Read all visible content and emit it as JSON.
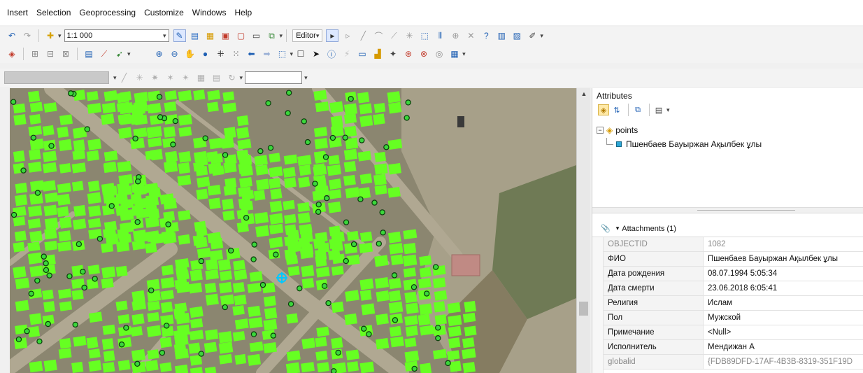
{
  "menu": [
    "Insert",
    "Selection",
    "Geoprocessing",
    "Customize",
    "Windows",
    "Help"
  ],
  "toolbar1": {
    "scale": "1:1 000",
    "editor_label": "Editor"
  },
  "toolbar3": {
    "combo_value": ""
  },
  "icons": [
    "undo-icon",
    "redo-icon",
    "add-data-icon",
    "zoom-in-icon",
    "zoom-out-icon",
    "pan-icon",
    "full-extent-icon",
    "identify-icon",
    "find-icon",
    "select-icon",
    "arrow-icon"
  ],
  "colors": {
    "parcel": "#66ff22",
    "point_fill": "#3bd63b",
    "point_stroke": "#0a3a0a",
    "selected": "#00c8ff"
  },
  "attributes_panel": {
    "title": "Attributes",
    "layer": "points",
    "feature": "Пшенбаев Бауыржан Ақылбек ұлы",
    "attachments_label": "Attachments (1)",
    "fields": [
      {
        "key": "OBJECTID",
        "value": "1082"
      },
      {
        "key": "ФИО",
        "value": "Пшенбаев Бауыржан Ақылбек ұлы"
      },
      {
        "key": "Дата рождения",
        "value": "08.07.1994 5:05:34"
      },
      {
        "key": "Дата смерти",
        "value": "23.06.2018 6:05:41"
      },
      {
        "key": "Религия",
        "value": "Ислам"
      },
      {
        "key": "Пол",
        "value": "Мужской"
      },
      {
        "key": "Примечание",
        "value": "<Null>"
      },
      {
        "key": "Исполнитель",
        "value": "Мендижан А"
      },
      {
        "key": "globalid",
        "value": "{FDB89DFD-17AF-4B3B-8319-351F19D"
      }
    ]
  }
}
